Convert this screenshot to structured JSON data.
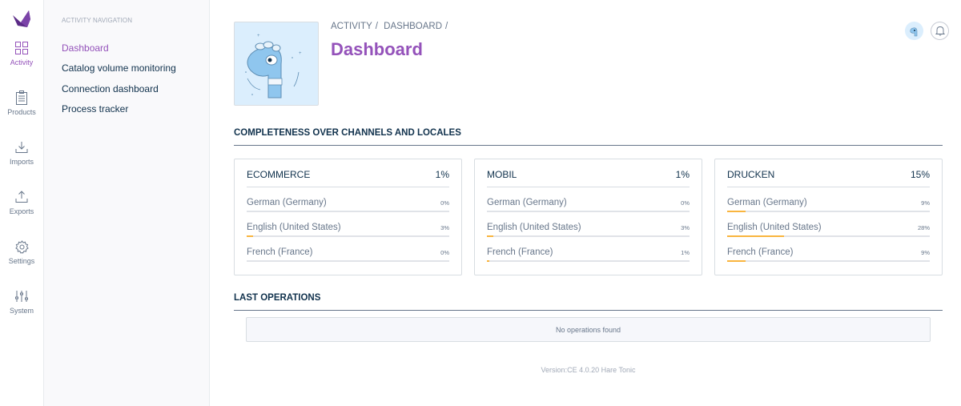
{
  "menu": {
    "items": [
      {
        "label": "Activity",
        "icon": "grid-icon",
        "active": true
      },
      {
        "label": "Products",
        "icon": "clipboard-icon",
        "active": false
      },
      {
        "label": "Imports",
        "icon": "import-icon",
        "active": false
      },
      {
        "label": "Exports",
        "icon": "export-icon",
        "active": false
      },
      {
        "label": "Settings",
        "icon": "gear-icon",
        "active": false
      },
      {
        "label": "System",
        "icon": "sliders-icon",
        "active": false
      }
    ]
  },
  "colnav": {
    "title": "Activity navigation",
    "items": [
      {
        "label": "Dashboard",
        "active": true
      },
      {
        "label": "Catalog volume monitoring",
        "active": false
      },
      {
        "label": "Connection dashboard",
        "active": false
      },
      {
        "label": "Process tracker",
        "active": false
      }
    ]
  },
  "header": {
    "breadcrumb": [
      "Activity",
      "Dashboard"
    ],
    "breadcrumb_separator": "/",
    "title": "Dashboard"
  },
  "completeness": {
    "title": "Completeness over channels and locales",
    "channels": [
      {
        "name": "Ecommerce",
        "percent": "1%",
        "locales": [
          {
            "name": "German (Germany)",
            "percent": "0%",
            "value": 0
          },
          {
            "name": "English (United States)",
            "percent": "3%",
            "value": 3
          },
          {
            "name": "French (France)",
            "percent": "0%",
            "value": 0
          }
        ]
      },
      {
        "name": "Mobil",
        "percent": "1%",
        "locales": [
          {
            "name": "German (Germany)",
            "percent": "0%",
            "value": 0
          },
          {
            "name": "English (United States)",
            "percent": "3%",
            "value": 3
          },
          {
            "name": "French (France)",
            "percent": "1%",
            "value": 1
          }
        ]
      },
      {
        "name": "Drucken",
        "percent": "15%",
        "locales": [
          {
            "name": "German (Germany)",
            "percent": "9%",
            "value": 9
          },
          {
            "name": "English (United States)",
            "percent": "28%",
            "value": 28
          },
          {
            "name": "French (France)",
            "percent": "9%",
            "value": 9
          }
        ]
      }
    ]
  },
  "last_operations": {
    "title": "Last operations",
    "empty_message": "No operations found"
  },
  "footer": {
    "version": "Version:CE 4.0.20 Hare Tonic"
  },
  "colors": {
    "brand": "#9452ba",
    "progress": "#f9b53f",
    "text": "#11324d",
    "muted": "#67768a"
  }
}
